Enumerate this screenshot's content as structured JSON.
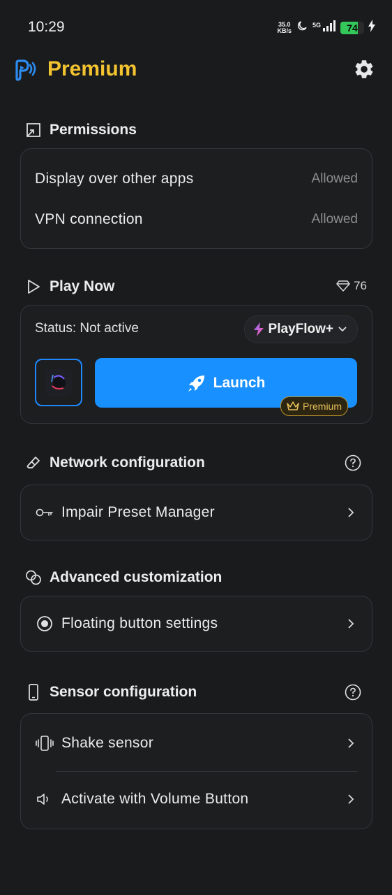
{
  "status_bar": {
    "time": "10:29",
    "net_speed_value": "35.0",
    "net_speed_unit": "KB/s",
    "network": "5G",
    "battery_level": "74",
    "battery_fraction": 0.74,
    "icons": [
      "moon-icon",
      "signal-icon",
      "battery-icon",
      "charging-icon"
    ]
  },
  "header": {
    "title": "Premium",
    "title_color": "#f4c430",
    "logo_icon": "app-logo-icon",
    "settings_icon": "gear-icon"
  },
  "permissions": {
    "title": "Permissions",
    "items": [
      {
        "label": "Display over other apps",
        "value": "Allowed"
      },
      {
        "label": "VPN connection",
        "value": "Allowed"
      }
    ]
  },
  "play_now": {
    "title": "Play Now",
    "gem_count": "76",
    "status_label": "Status: Not active",
    "engine": "PlayFlow+",
    "launch_label": "Launch",
    "premium_badge": "Premium",
    "accent_color": "#1890ff"
  },
  "network": {
    "title": "Network configuration",
    "items": [
      {
        "label": "Impair Preset Manager",
        "icon": "key-icon"
      }
    ]
  },
  "advanced": {
    "title": "Advanced customization",
    "items": [
      {
        "label": "Floating button settings",
        "icon": "radio-dot-icon"
      }
    ]
  },
  "sensor": {
    "title": "Sensor configuration",
    "items": [
      {
        "label": "Shake sensor",
        "icon": "vibrate-phone-icon"
      },
      {
        "label": "Activate with Volume Button",
        "icon": "volume-icon"
      }
    ]
  }
}
